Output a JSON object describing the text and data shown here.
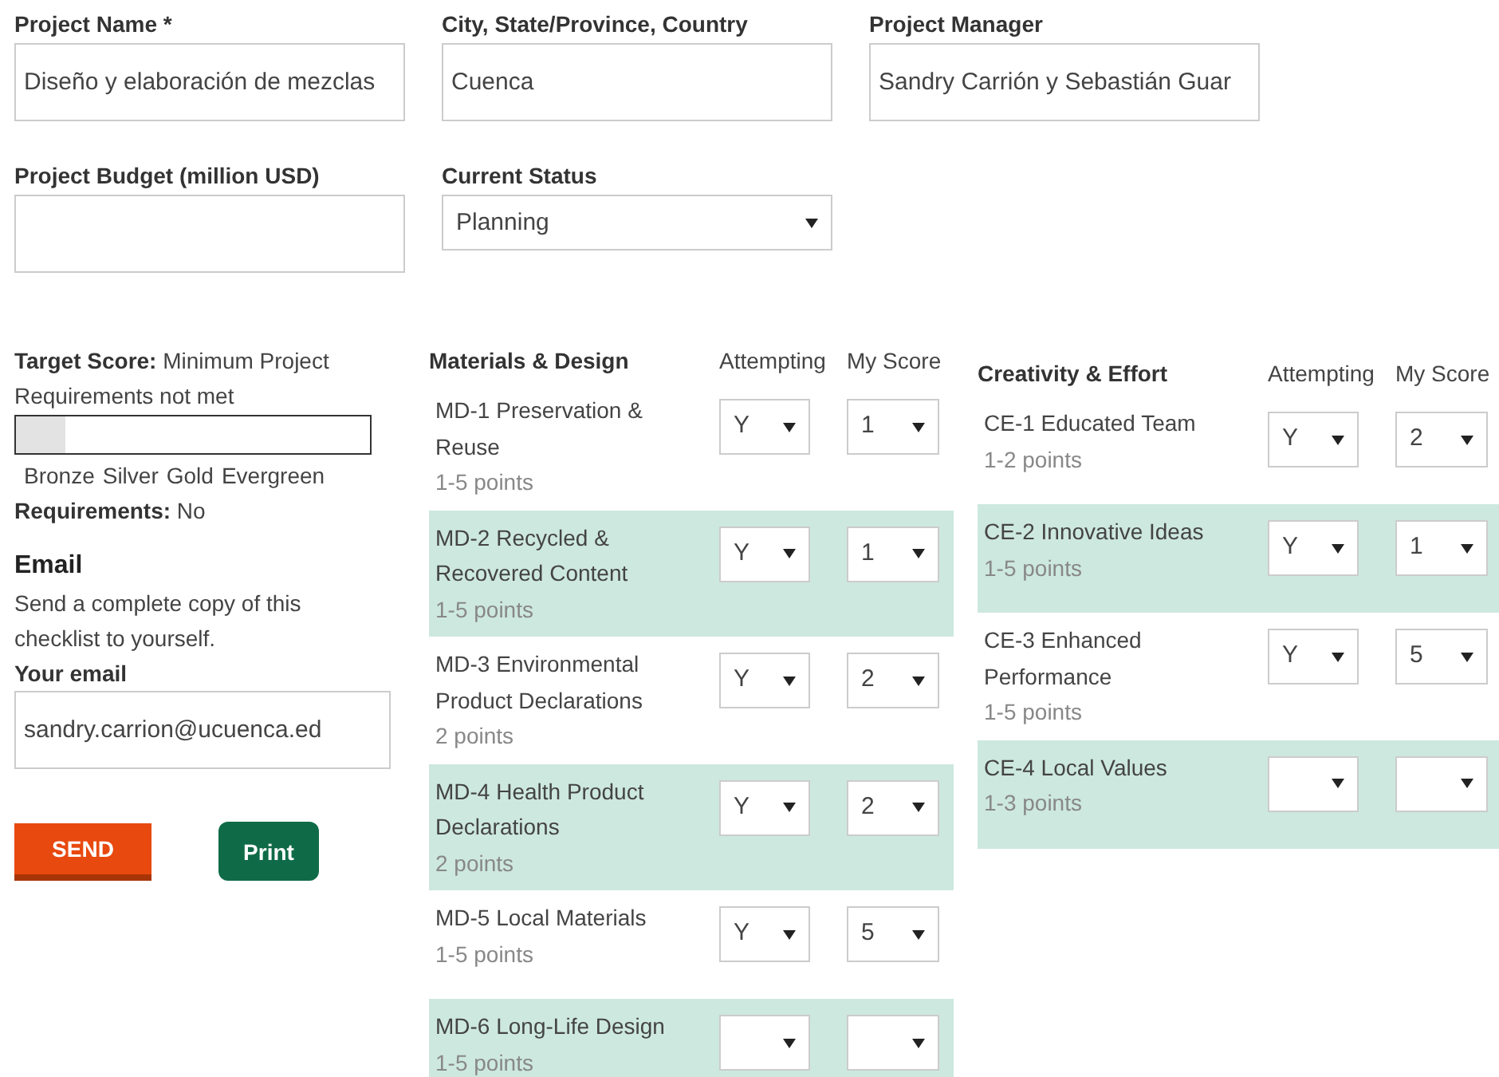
{
  "project_fields": [
    {
      "label": "Project Name *",
      "kind": "text",
      "value": "Diseño y elaboración de mezclas"
    },
    {
      "label": "City, State/Province, Country",
      "kind": "text",
      "value": "Cuenca"
    },
    {
      "label": "Project Manager",
      "kind": "text",
      "value": "Sandry Carrión y Sebastián Guar"
    },
    {
      "label": "Project Budget (million USD)",
      "kind": "text"
    },
    {
      "label": "Current Status",
      "kind": "select",
      "value": "Planning"
    }
  ],
  "score_panel": {
    "target": "**Target Score:** Minimum Project Requirements not met",
    "level": 0.14,
    "tiers": [
      "Bronze",
      "Silver",
      "Gold",
      "Evergreen"
    ],
    "requirements": "**Requirements:** No"
  },
  "email": {
    "heading": "Email",
    "description": "Send a complete copy of this checklist to yourself.",
    "label": "Your email",
    "value": "sandry.carrion@ucuenca.ed"
  },
  "buttons": [
    {
      "label": "SEND",
      "kind": "primary"
    },
    {
      "label": "Print",
      "kind": "secondary"
    }
  ],
  "sections": [
    {
      "title": "Materials & Design",
      "columns": [
        "Attempting",
        "My Score"
      ],
      "items": [
        {
          "name": "MD-1 Preservation & Reuse",
          "points": "1-5 points",
          "attempting": "Y",
          "score": "1"
        },
        {
          "name": "MD-2 Recycled & Recovered Content",
          "points": "1-5 points",
          "attempting": "Y",
          "score": "1"
        },
        {
          "name": "MD-3 Environmental Product Declarations",
          "points": "2 points",
          "attempting": "Y",
          "score": "2"
        },
        {
          "name": "MD-4 Health Product Declarations",
          "points": "2 points",
          "attempting": "Y",
          "score": "2"
        },
        {
          "name": "MD-5 Local Materials",
          "points": "1-5 points",
          "attempting": "Y",
          "score": "5"
        },
        {
          "name": "MD-6 Long-Life Design",
          "points": "1-5 points"
        }
      ]
    },
    {
      "title": "Creativity & Effort",
      "columns": [
        "Attempting",
        "My Score"
      ],
      "items": [
        {
          "name": "CE-1 Educated Team",
          "points": "1-2 points",
          "attempting": "Y",
          "score": "2"
        },
        {
          "name": "CE-2 Innovative Ideas",
          "points": "1-5 points",
          "attempting": "Y",
          "score": "1"
        },
        {
          "name": "CE-3 Enhanced Performance",
          "points": "1-5 points",
          "attempting": "Y",
          "score": "5"
        },
        {
          "name": "CE-4 Local Values",
          "points": "1-3 points"
        }
      ]
    }
  ]
}
